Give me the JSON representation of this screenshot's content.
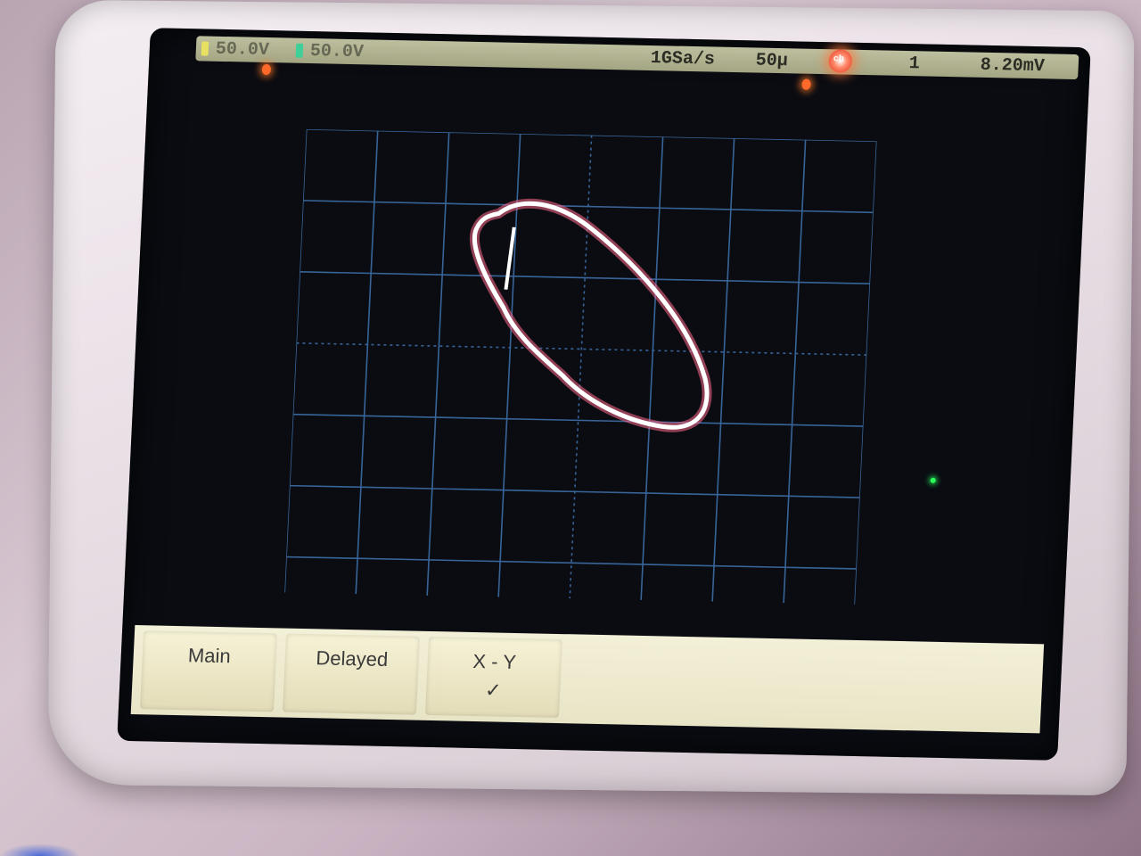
{
  "statusbar": {
    "ch1_scale": "50.0V",
    "ch2_scale": "50.0V",
    "sample_rate": "1GSa/s",
    "timebase": "50μ",
    "trigger_badge": "ch",
    "trigger_source": "1",
    "trigger_level": "8.20mV"
  },
  "display": {
    "grid": {
      "cols": 8,
      "rows": 6
    },
    "trace_shape": "ellipse (X-Y mode Lissajous)"
  },
  "softkeys": [
    {
      "label": "Main",
      "sub": "",
      "selected": false
    },
    {
      "label": "Delayed",
      "sub": "",
      "selected": false
    },
    {
      "label": "X - Y",
      "sub": "✓",
      "selected": true
    }
  ],
  "colors": {
    "trace": "#ffffff",
    "trace_glow": "#ff6a8a",
    "grid": "#3e6fa8",
    "statusbar": "#b4b693",
    "softkey_bg": "#f0ecd2"
  }
}
